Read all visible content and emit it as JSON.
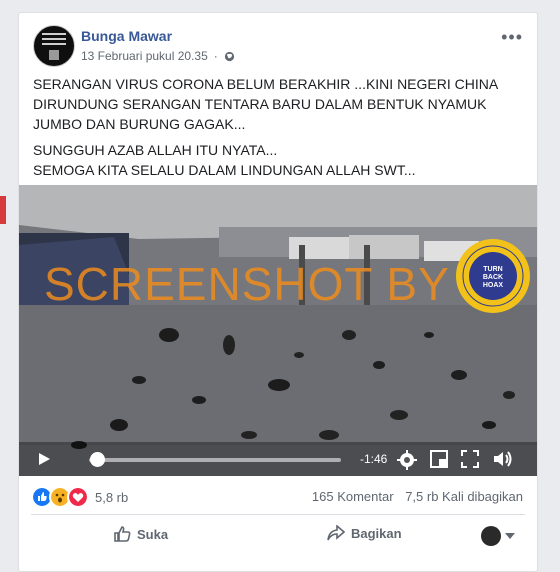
{
  "post": {
    "author": "Bunga Mawar",
    "timestamp": "13 Februari pukul 20.35",
    "privacy_icon": "globe-icon",
    "text": [
      "SERANGAN VIRUS CORONA BELUM BERAKHIR ...KINI NEGERI CHINA DIRUNDUNG SERANGAN TENTARA BARU DALAM BENTUK NYAMUK JUMBO DAN BURUNG GAGAK...",
      "SUNGGUH AZAB ALLAH ITU NYATA...",
      "SEMOGA KITA SELALU DALAM LINDUNGAN ALLAH SWT..."
    ]
  },
  "video": {
    "watermark": "SCREENSHOT BY",
    "logo_text": "TURN BACK HOAX",
    "time_remaining": "-1:46",
    "progress": 0.03
  },
  "footer": {
    "reaction_count": "5,8 rb",
    "comments": "165 Komentar",
    "shares": "7,5 rb Kali dibagikan",
    "like_label": "Suka",
    "share_label": "Bagikan"
  },
  "colors": {
    "link": "#385898",
    "like": "#1877f2",
    "love": "#f0284a",
    "wow": "#f7b125",
    "watermark": "#ee8c1e"
  }
}
